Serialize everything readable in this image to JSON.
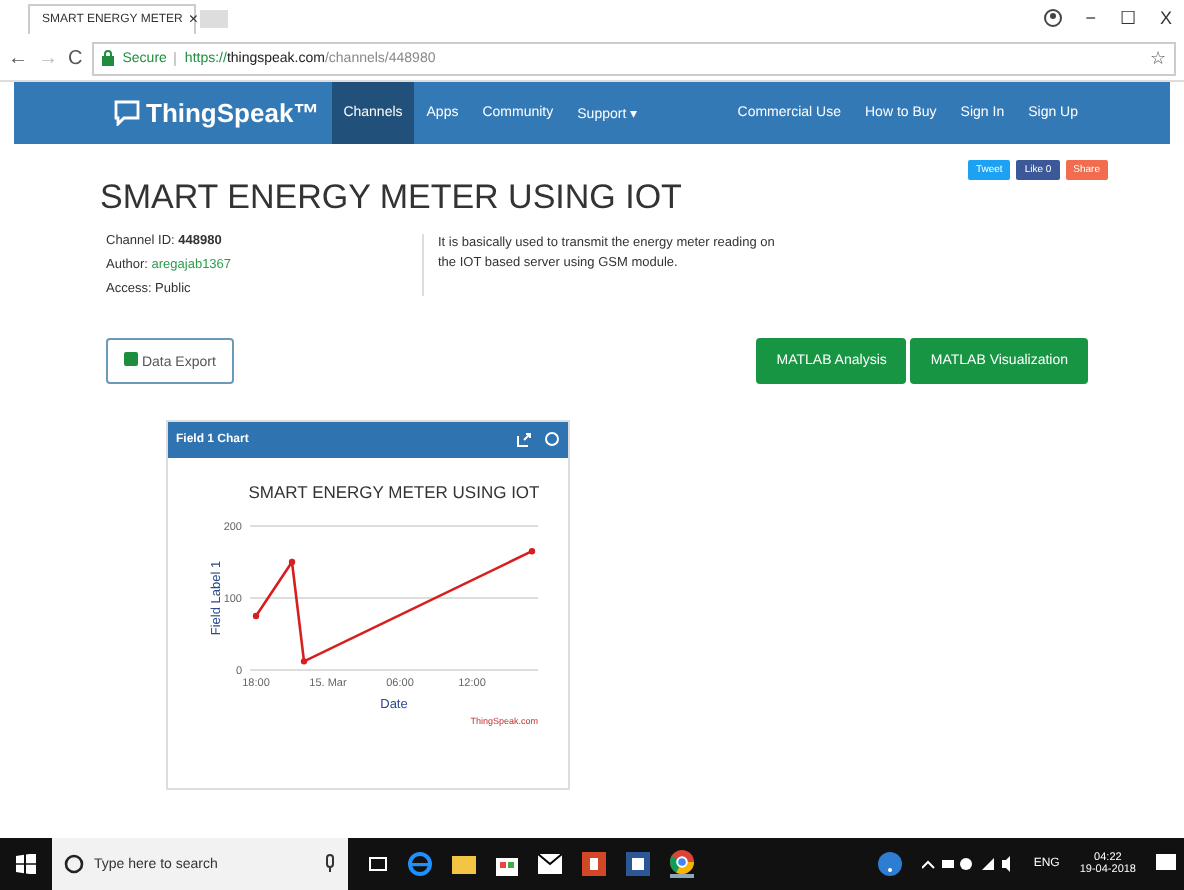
{
  "browser": {
    "tab_title": "SMART ENERGY METER",
    "tab_close": "×",
    "secure_label": "Secure",
    "nav_buttons": [
      "←",
      "→",
      "C"
    ],
    "star": "☆",
    "url_scheme": "https://",
    "url_host": "thingspeak.com",
    "url_path": "/channels/448980",
    "window_controls": [
      "−",
      "☐",
      "X"
    ]
  },
  "nav": {
    "brand": "ThingSpeak™",
    "left": [
      {
        "label": "Channels",
        "selected": true
      },
      {
        "label": "Apps",
        "selected": false
      },
      {
        "label": "Community",
        "selected": false
      },
      {
        "label": "Support ▾",
        "selected": false
      }
    ],
    "right": [
      {
        "label": "Commercial Use"
      },
      {
        "label": "How to Buy"
      },
      {
        "label": "Sign In"
      },
      {
        "label": "Sign Up"
      }
    ]
  },
  "share": [
    {
      "label": "Tweet",
      "color": "#1da1f2"
    },
    {
      "label": "Like 0",
      "color": "#3b5998"
    },
    {
      "label": "Share",
      "color": "#f26c4f"
    }
  ],
  "channel": {
    "title": "SMART ENERGY METER USING IOT",
    "id_label": "Channel ID:",
    "id": "448980",
    "author_label": "Author:",
    "author": "aregajab1367",
    "access": "Access: Public",
    "description": "It is basically used to transmit the energy meter reading on the IOT based server using GSM module."
  },
  "buttons": {
    "export": "Data Export",
    "actions": [
      "MATLAB Analysis",
      "MATLAB Visualization"
    ]
  },
  "card": {
    "title": "Field 1 Chart",
    "credit": "ThingSpeak.com",
    "chart_data": {
      "type": "line",
      "title": "SMART ENERGY METER USING IOT",
      "xlabel": "Date",
      "ylabel": "Field Label 1",
      "categories": [
        "18:00",
        null,
        null,
        null,
        null,
        null,
        "15. Mar",
        null,
        null,
        null,
        null,
        null,
        "06:00",
        null,
        null,
        null,
        null,
        null,
        "12:00",
        null,
        null,
        null,
        null,
        null
      ],
      "series": [
        {
          "color": "#d62020",
          "marker": true,
          "values": [
            75,
            null,
            null,
            150,
            12,
            null,
            null,
            null,
            null,
            null,
            null,
            null,
            null,
            null,
            null,
            null,
            null,
            null,
            null,
            null,
            null,
            null,
            null,
            165
          ]
        }
      ],
      "ylim": [
        0,
        200
      ],
      "yticks": [
        0,
        100,
        200
      ]
    }
  },
  "taskbar": {
    "search_placeholder": "Type here to search",
    "tray_lang": "ENG",
    "time": "04:22",
    "date": "19-04-2018"
  }
}
